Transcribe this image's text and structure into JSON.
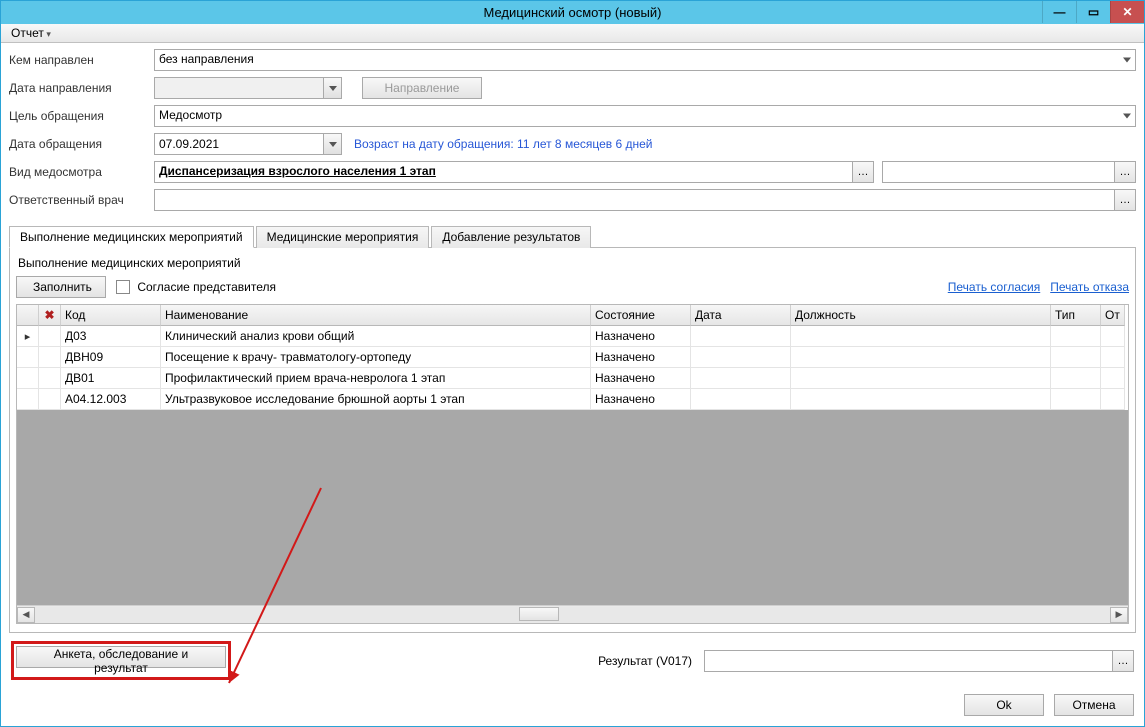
{
  "window": {
    "title": "Медицинский осмотр (новый)"
  },
  "menu": {
    "report": "Отчет"
  },
  "form": {
    "referrer_label": "Кем направлен",
    "referrer_value": "без направления",
    "refdate_label": "Дата направления",
    "refdate_value": "",
    "referral_btn": "Направление",
    "purpose_label": "Цель обращения",
    "purpose_value": "Медосмотр",
    "visitdate_label": "Дата обращения",
    "visitdate_value": "07.09.2021",
    "age_hint": "Возраст на дату обращения:  11 лет 8 месяцев 6 дней",
    "examtype_label": "Вид медосмотра",
    "examtype_value": "Диспансеризация взрослого населения 1 этап",
    "examtype_value2": "",
    "doctor_label": "Ответственный врач",
    "doctor_value": ""
  },
  "tabs": {
    "t1": "Выполнение медицинских мероприятий",
    "t2": "Медицинские мероприятия",
    "t3": "Добавление результатов"
  },
  "section": {
    "title": "Выполнение медицинских мероприятий",
    "fill_btn": "Заполнить",
    "consent_cb": "Согласие представителя",
    "link_consent": "Печать согласия",
    "link_refusal": "Печать отказа"
  },
  "grid": {
    "headers": {
      "code": "Код",
      "name": "Наименование",
      "state": "Состояние",
      "date": "Дата",
      "position": "Должность",
      "type": "Тип",
      "ot": "От"
    },
    "rows": [
      {
        "code": "Д03",
        "name": "Клинический анализ крови общий",
        "state": "Назначено",
        "date": "",
        "position": "",
        "type": "",
        "ot": ""
      },
      {
        "code": "ДВН09",
        "name": "Посещение к врачу- травматологу-ортопеду",
        "state": "Назначено",
        "date": "",
        "position": "",
        "type": "",
        "ot": ""
      },
      {
        "code": "ДВ01",
        "name": "Профилактический прием врача-невролога 1 этап",
        "state": "Назначено",
        "date": "",
        "position": "",
        "type": "",
        "ot": ""
      },
      {
        "code": "А04.12.003",
        "name": "Ультразвуковое исследование брюшной аорты 1 этап",
        "state": "Назначено",
        "date": "",
        "position": "",
        "type": "",
        "ot": ""
      }
    ]
  },
  "footer": {
    "survey_btn": "Анкета, обследование и результат",
    "result_label": "Результат (V017)",
    "result_value": ""
  },
  "dialog": {
    "ok": "Ok",
    "cancel": "Отмена"
  }
}
